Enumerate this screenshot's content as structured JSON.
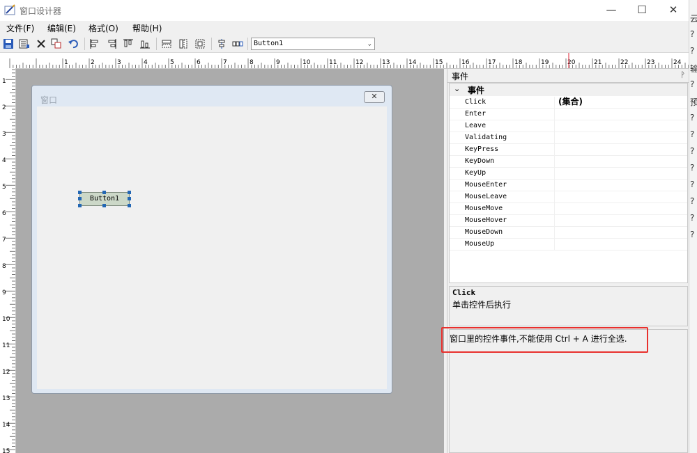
{
  "window": {
    "title": "窗口设计器",
    "minimize": "—",
    "maximize": "☐",
    "close": "✕"
  },
  "menu": [
    "文件(F)",
    "编辑(E)",
    "格式(O)",
    "帮助(H)"
  ],
  "toolbar": {
    "icons": [
      "save-icon",
      "form-props-icon",
      "delete-icon",
      "copy-icon",
      "undo-icon",
      "align-left-icon",
      "align-right-icon",
      "align-top-icon",
      "align-bottom-icon",
      "same-width-icon",
      "same-height-icon",
      "same-size-icon",
      "center-horizontal-icon",
      "space-horizontal-icon"
    ],
    "control_selector": "Button1"
  },
  "ruler": {
    "h_numbers": [
      "1",
      "2",
      "3",
      "4",
      "5",
      "6",
      "7",
      "8",
      "9",
      "10",
      "11",
      "12",
      "13",
      "14",
      "15",
      "16",
      "17",
      "18",
      "19",
      "20",
      "21",
      "22",
      "23",
      "24"
    ],
    "v_numbers": [
      "1",
      "2",
      "3",
      "4",
      "5",
      "6",
      "7",
      "8",
      "9",
      "10",
      "11",
      "12",
      "13",
      "14",
      "15"
    ]
  },
  "form": {
    "title": "窗口",
    "close_glyph": "✕",
    "button_label": "Button1"
  },
  "events_panel": {
    "title": "事件",
    "pin": "ᚹ",
    "category": "事件",
    "rows": [
      {
        "name": "Click",
        "value": "(集合)"
      },
      {
        "name": "Enter",
        "value": ""
      },
      {
        "name": "Leave",
        "value": ""
      },
      {
        "name": "Validating",
        "value": ""
      },
      {
        "name": "KeyPress",
        "value": ""
      },
      {
        "name": "KeyDown",
        "value": ""
      },
      {
        "name": "KeyUp",
        "value": ""
      },
      {
        "name": "MouseEnter",
        "value": ""
      },
      {
        "name": "MouseLeave",
        "value": ""
      },
      {
        "name": "MouseMove",
        "value": ""
      },
      {
        "name": "MouseHover",
        "value": ""
      },
      {
        "name": "MouseDown",
        "value": ""
      },
      {
        "name": "MouseUp",
        "value": ""
      }
    ],
    "description_title": "Click",
    "description_text": "单击控件后执行",
    "tip_text": "窗口里的控件事件,不能使用 Ctrl + A 进行全选."
  },
  "right_strip": [
    "云",
    "?",
    "?",
    "输",
    "?",
    "预",
    "?",
    "?",
    "?",
    "?",
    "?",
    "?",
    "?",
    "?"
  ],
  "colors": {
    "highlight": "#e8302d",
    "selection_handle": "#2367b4",
    "canvas": "#ababab"
  }
}
